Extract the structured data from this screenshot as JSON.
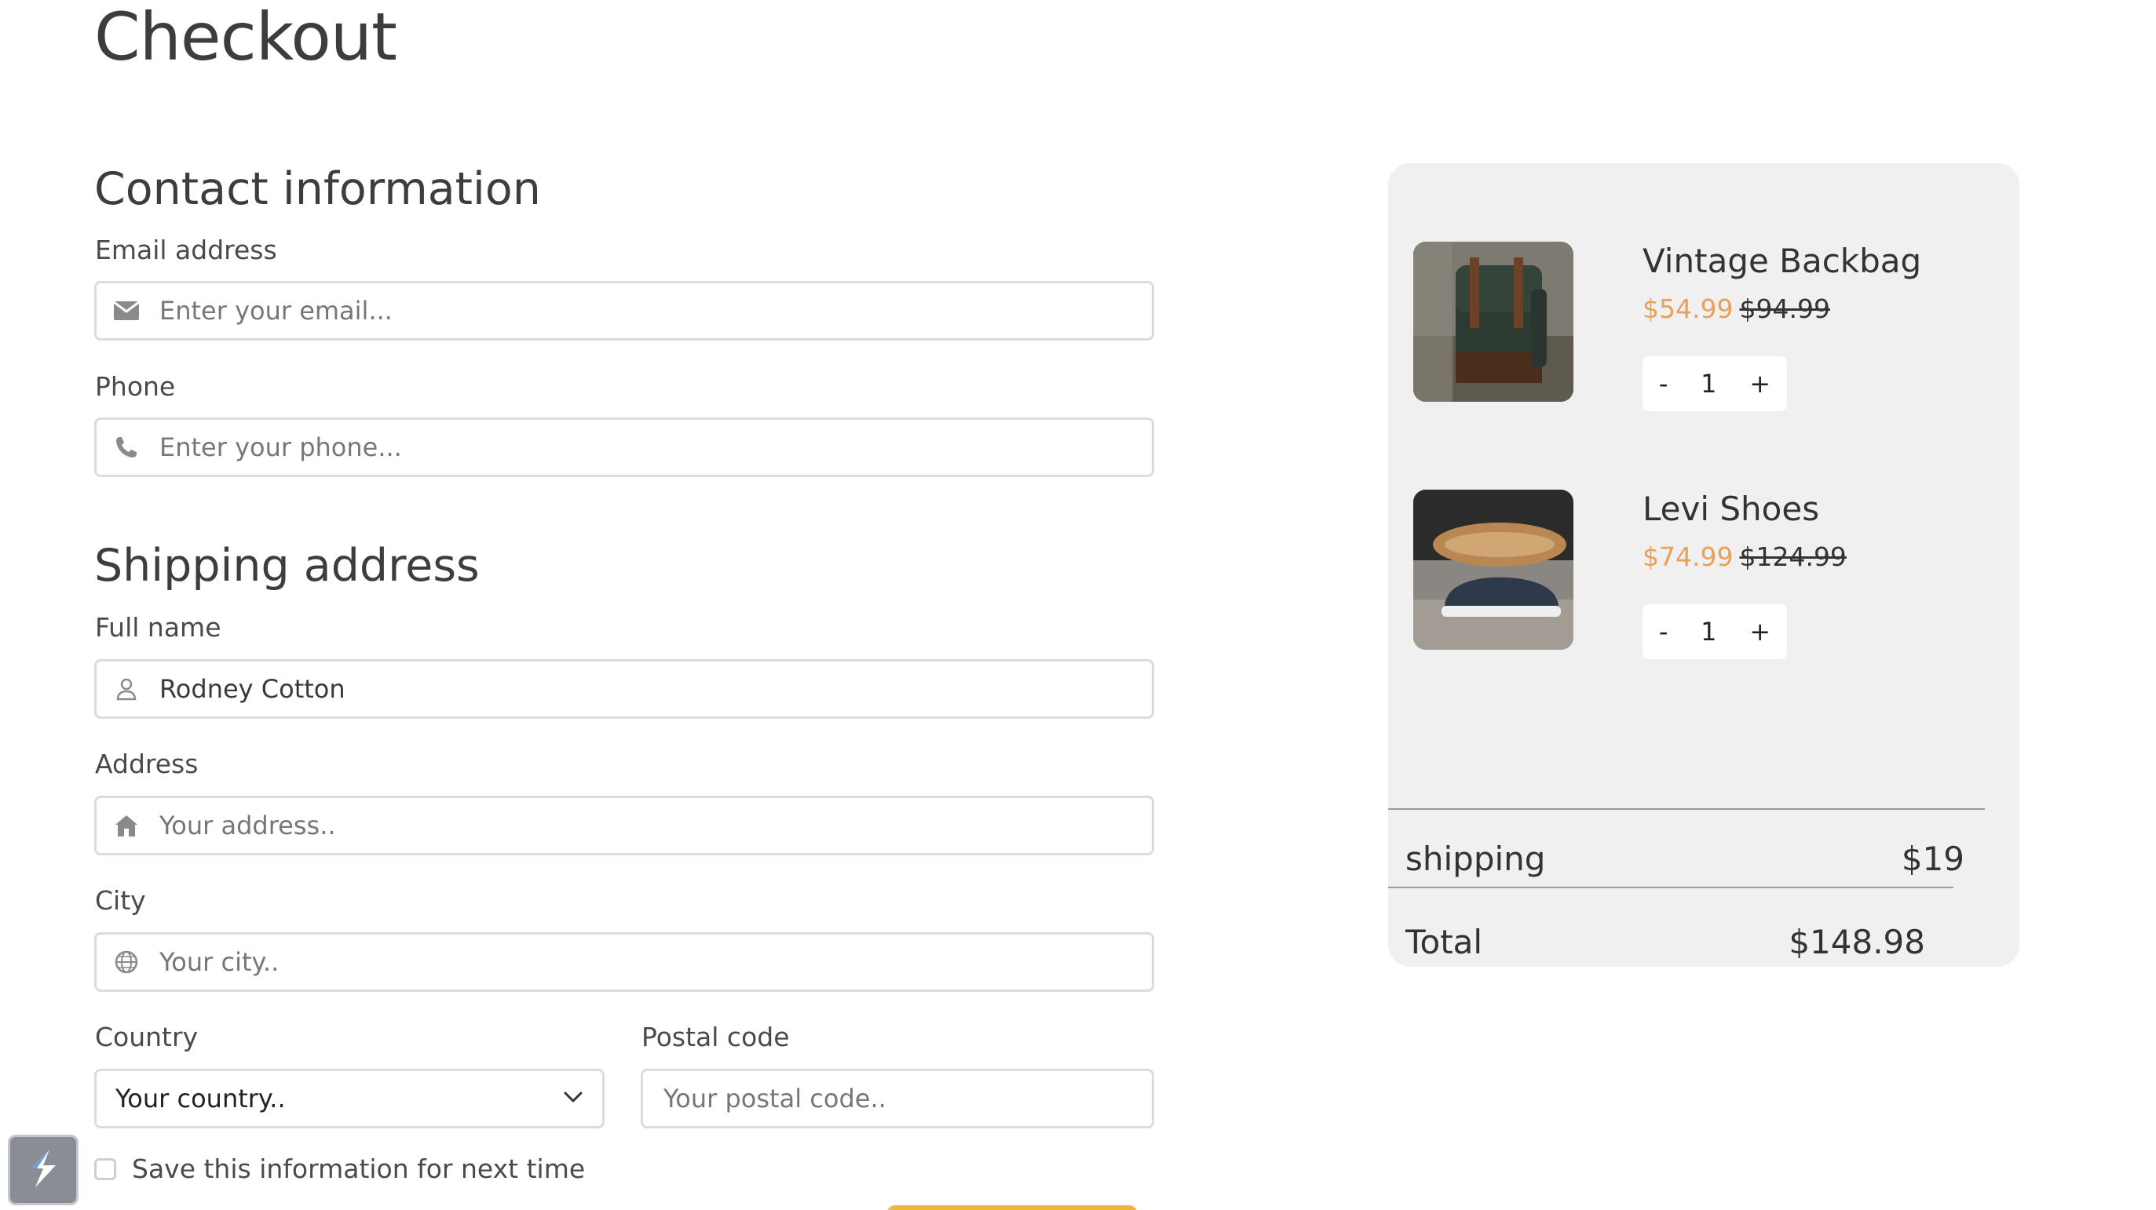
{
  "page_title": "Checkout",
  "contact": {
    "title": "Contact information",
    "email_label": "Email address",
    "email_placeholder": "Enter your email...",
    "phone_label": "Phone",
    "phone_placeholder": "Enter your phone..."
  },
  "shipping": {
    "title": "Shipping address",
    "fullname_label": "Full name",
    "fullname_value": "Rodney Cotton",
    "address_label": "Address",
    "address_placeholder": "Your address..",
    "city_label": "City",
    "city_placeholder": "Your city..",
    "country_label": "Country",
    "country_value": "Your country..",
    "postal_label": "Postal code",
    "postal_placeholder": "Your postal code..",
    "save_info_label": "Save this information for next time"
  },
  "cart": {
    "items": [
      {
        "name": "Vintage Backbag",
        "price": "$54.99",
        "old_price": "$94.99",
        "qty": "1",
        "minus": "-",
        "plus": "+"
      },
      {
        "name": "Levi Shoes",
        "price": "$74.99",
        "old_price": "$124.99",
        "qty": "1",
        "minus": "-",
        "plus": "+"
      }
    ],
    "shipping_label": "shipping",
    "shipping_value": "$19",
    "total_label": "Total",
    "total_value": "$148.98"
  },
  "colors": {
    "accent_price": "#e8a15a",
    "submit_button": "#f0b440",
    "cart_bg": "#f0f0f0"
  },
  "icons": {
    "email": "envelope-icon",
    "phone": "phone-icon",
    "fullname": "user-icon",
    "address": "home-icon",
    "city": "globe-icon",
    "country": "chevron-down-icon"
  }
}
